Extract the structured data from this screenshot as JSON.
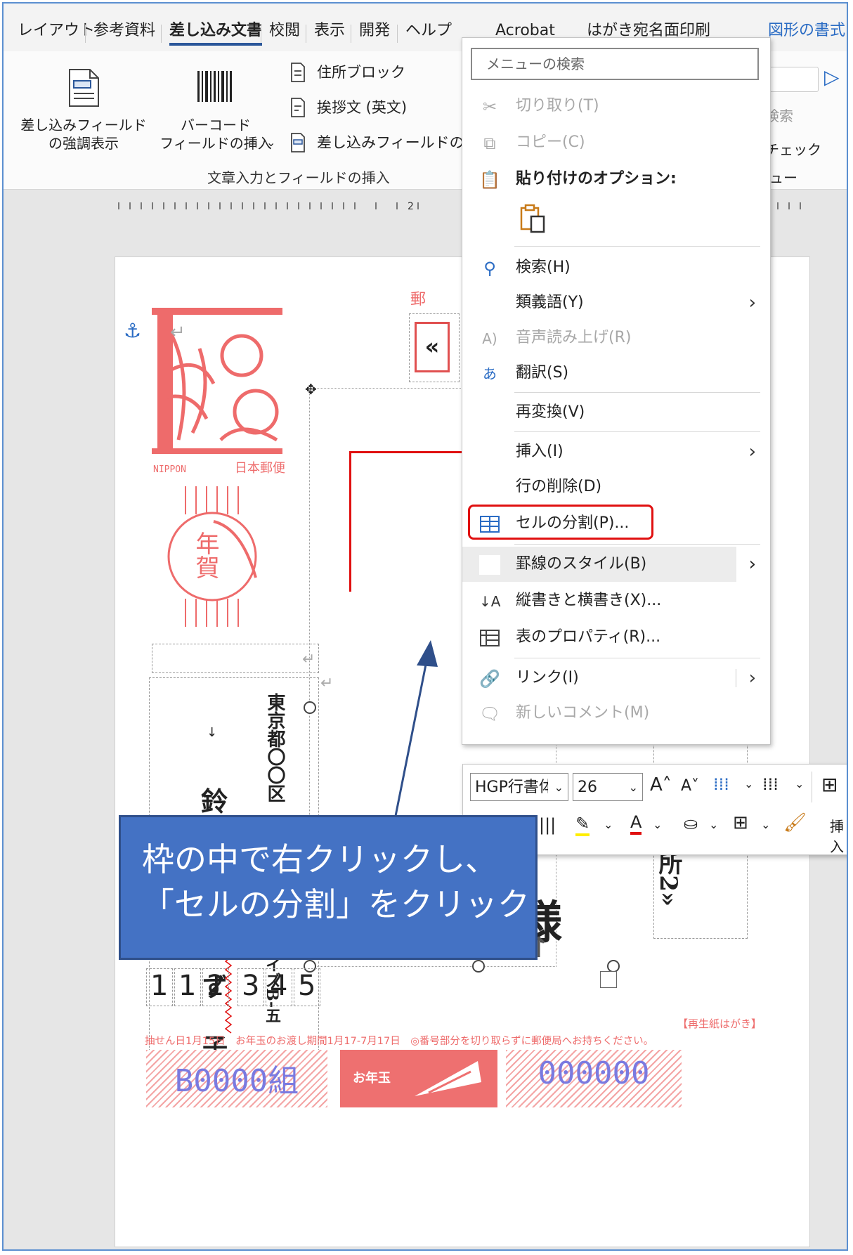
{
  "ribbon": {
    "tabs": [
      {
        "label": "レイアウト"
      },
      {
        "label": "参考資料"
      },
      {
        "label": "差し込み文書",
        "active": true
      },
      {
        "label": "校閲"
      },
      {
        "label": "表示"
      },
      {
        "label": "開発"
      },
      {
        "label": "ヘルプ"
      },
      {
        "label": "Acrobat"
      },
      {
        "label": "はがき宛名面印刷"
      },
      {
        "label": "図形の書式"
      }
    ],
    "highlight_fields": {
      "line1": "差し込みフィールド",
      "line2": "の強調表示"
    },
    "barcode_field": {
      "line1": "バーコード",
      "line2": "フィールドの挿入"
    },
    "address_block": "住所ブロック",
    "greeting_line": "挨拶文 (英文)",
    "insert_merge_field": "差し込みフィールドの挿入",
    "group_label": "文章入力とフィールドの挿入",
    "right_find": "検索",
    "right_check": "チェック",
    "right_preview": "ュー"
  },
  "ruler": {
    "mark": "2"
  },
  "context_menu": {
    "search_placeholder": "メニューの検索",
    "items": {
      "cut": "切り取り(T)",
      "copy": "コピー(C)",
      "paste_options": "貼り付けのオプション:",
      "search": "検索(H)",
      "synonyms": "類義語(Y)",
      "read_aloud": "音声読み上げ(R)",
      "translate": "翻訳(S)",
      "reconvert": "再変換(V)",
      "insert": "挿入(I)",
      "delete_row": "行の削除(D)",
      "split_cells": "セルの分割(P)...",
      "border_styles": "罫線のスタイル(B)",
      "text_direction": "縦書きと横書き(X)...",
      "table_properties": "表のプロパティ(R)...",
      "link": "リンク(I)",
      "new_comment": "新しいコメント(M)"
    }
  },
  "mini_toolbar": {
    "font_name": "HGP行書体",
    "font_size": "26",
    "insert_label": "挿入"
  },
  "postcard": {
    "stamp_text_left": "NIPPON",
    "stamp_text_right": "日本郵便",
    "stamp_chars": "年賀",
    "postal_label": "郵",
    "name_chars": [
      "鈴",
      "ず",
      "子"
    ],
    "address_text": "東京都〇〇区",
    "address_tail": "イズB-五",
    "honorific": "様",
    "address2": "«住所2»",
    "merge_symbol": "«",
    "postal_code": [
      "1",
      "1",
      "2",
      "3",
      "4",
      "5"
    ],
    "recycled_note": "【再生紙はがき】",
    "footnote": "抽せん日1月15日　お年玉のお渡し期間1月17-7月17日　◎番号部分を切り取らずに郵便局へお持ちください。",
    "lottery_group": "B0000組",
    "otoshidama": "お年玉",
    "lottery_number": "000000"
  },
  "callout": {
    "line1": "枠の中で右クリックし、",
    "line2": "「セルの分割」をクリック"
  },
  "colors": {
    "accent": "#2b579a",
    "callout": "#4472c4",
    "highlight": "#e01010",
    "stamp": "#ee6b6b"
  }
}
